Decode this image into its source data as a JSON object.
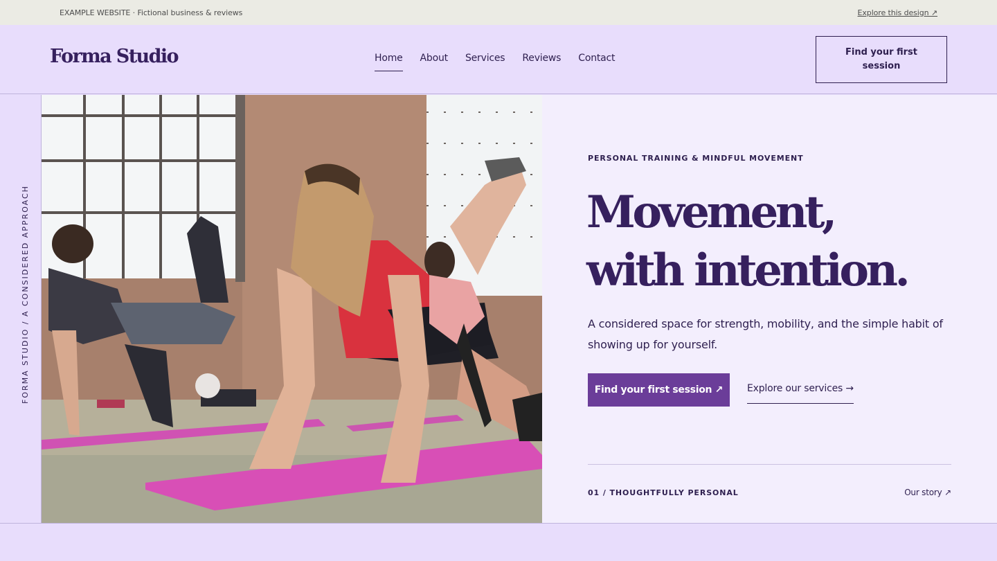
{
  "topbar": {
    "site_label": "EXAMPLE WEBSITE · Fictional business & reviews",
    "explore_link": "Explore this design ↗"
  },
  "header": {
    "logo": "Forma Studio",
    "nav": [
      {
        "label": "Home",
        "active": true
      },
      {
        "label": "About"
      },
      {
        "label": "Services"
      },
      {
        "label": "Reviews"
      },
      {
        "label": "Contact"
      }
    ],
    "cta": "Find your first session"
  },
  "sidebar": {
    "vertical_text": "FORMA STUDIO / A CONSIDERED APPROACH"
  },
  "hero": {
    "eyebrow": "PERSONAL TRAINING & MINDFUL MOVEMENT",
    "headline_line1": "Movement,",
    "headline_line2": "with intention.",
    "subtext": "A considered space for strength, mobility, and the simple habit of showing up for yourself.",
    "primary_button": "Find your first session ↗",
    "secondary_link": "Explore our services →",
    "footer_label": "01 / THOUGHTFULLY PERSONAL",
    "footer_link": "Our story ↗"
  },
  "colors": {
    "lavender": "#e8ddfc",
    "hero_bg": "#f3eefd",
    "deep_purple": "#36205e",
    "button_purple": "#6b3d99",
    "topbar_bg": "#ebebe4"
  }
}
